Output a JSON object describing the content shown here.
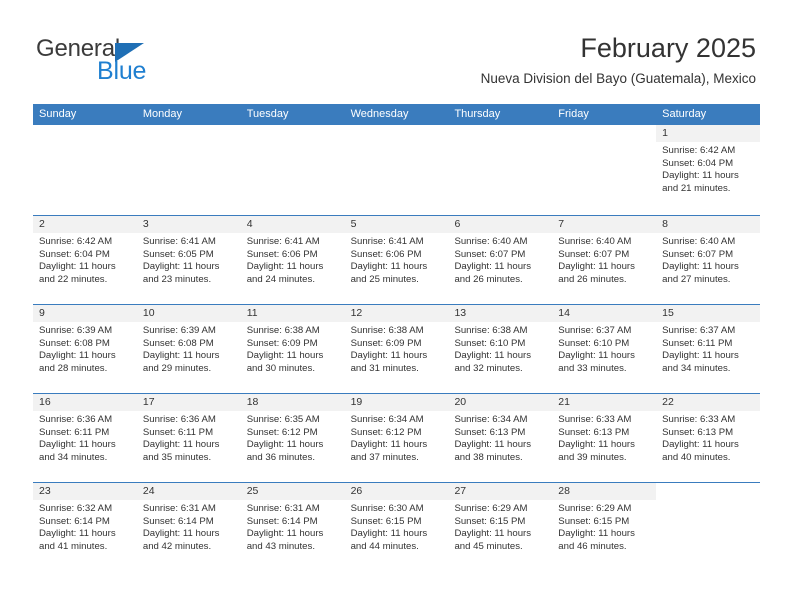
{
  "brand": {
    "name_top": "General",
    "name_bottom": "Blue",
    "triangle_color": "#1f6fb5",
    "blue_color": "#1f7fd0"
  },
  "header": {
    "month_title": "February 2025",
    "location": "Nueva Division del Bayo (Guatemala), Mexico"
  },
  "colors": {
    "header_blue": "#3a7cbe",
    "daynum_band": "#f2f2f2",
    "text": "#333333"
  },
  "weekdays": [
    "Sunday",
    "Monday",
    "Tuesday",
    "Wednesday",
    "Thursday",
    "Friday",
    "Saturday"
  ],
  "labels": {
    "sunrise_prefix": "Sunrise:",
    "sunset_prefix": "Sunset:",
    "daylight_prefix": "Daylight:"
  },
  "weeks": [
    [
      {
        "empty": true
      },
      {
        "empty": true
      },
      {
        "empty": true
      },
      {
        "empty": true
      },
      {
        "empty": true
      },
      {
        "empty": true
      },
      {
        "day": "1",
        "sunrise": "Sunrise: 6:42 AM",
        "sunset": "Sunset: 6:04 PM",
        "daylight": "Daylight: 11 hours and 21 minutes."
      }
    ],
    [
      {
        "day": "2",
        "sunrise": "Sunrise: 6:42 AM",
        "sunset": "Sunset: 6:04 PM",
        "daylight": "Daylight: 11 hours and 22 minutes."
      },
      {
        "day": "3",
        "sunrise": "Sunrise: 6:41 AM",
        "sunset": "Sunset: 6:05 PM",
        "daylight": "Daylight: 11 hours and 23 minutes."
      },
      {
        "day": "4",
        "sunrise": "Sunrise: 6:41 AM",
        "sunset": "Sunset: 6:06 PM",
        "daylight": "Daylight: 11 hours and 24 minutes."
      },
      {
        "day": "5",
        "sunrise": "Sunrise: 6:41 AM",
        "sunset": "Sunset: 6:06 PM",
        "daylight": "Daylight: 11 hours and 25 minutes."
      },
      {
        "day": "6",
        "sunrise": "Sunrise: 6:40 AM",
        "sunset": "Sunset: 6:07 PM",
        "daylight": "Daylight: 11 hours and 26 minutes."
      },
      {
        "day": "7",
        "sunrise": "Sunrise: 6:40 AM",
        "sunset": "Sunset: 6:07 PM",
        "daylight": "Daylight: 11 hours and 26 minutes."
      },
      {
        "day": "8",
        "sunrise": "Sunrise: 6:40 AM",
        "sunset": "Sunset: 6:07 PM",
        "daylight": "Daylight: 11 hours and 27 minutes."
      }
    ],
    [
      {
        "day": "9",
        "sunrise": "Sunrise: 6:39 AM",
        "sunset": "Sunset: 6:08 PM",
        "daylight": "Daylight: 11 hours and 28 minutes."
      },
      {
        "day": "10",
        "sunrise": "Sunrise: 6:39 AM",
        "sunset": "Sunset: 6:08 PM",
        "daylight": "Daylight: 11 hours and 29 minutes."
      },
      {
        "day": "11",
        "sunrise": "Sunrise: 6:38 AM",
        "sunset": "Sunset: 6:09 PM",
        "daylight": "Daylight: 11 hours and 30 minutes."
      },
      {
        "day": "12",
        "sunrise": "Sunrise: 6:38 AM",
        "sunset": "Sunset: 6:09 PM",
        "daylight": "Daylight: 11 hours and 31 minutes."
      },
      {
        "day": "13",
        "sunrise": "Sunrise: 6:38 AM",
        "sunset": "Sunset: 6:10 PM",
        "daylight": "Daylight: 11 hours and 32 minutes."
      },
      {
        "day": "14",
        "sunrise": "Sunrise: 6:37 AM",
        "sunset": "Sunset: 6:10 PM",
        "daylight": "Daylight: 11 hours and 33 minutes."
      },
      {
        "day": "15",
        "sunrise": "Sunrise: 6:37 AM",
        "sunset": "Sunset: 6:11 PM",
        "daylight": "Daylight: 11 hours and 34 minutes."
      }
    ],
    [
      {
        "day": "16",
        "sunrise": "Sunrise: 6:36 AM",
        "sunset": "Sunset: 6:11 PM",
        "daylight": "Daylight: 11 hours and 34 minutes."
      },
      {
        "day": "17",
        "sunrise": "Sunrise: 6:36 AM",
        "sunset": "Sunset: 6:11 PM",
        "daylight": "Daylight: 11 hours and 35 minutes."
      },
      {
        "day": "18",
        "sunrise": "Sunrise: 6:35 AM",
        "sunset": "Sunset: 6:12 PM",
        "daylight": "Daylight: 11 hours and 36 minutes."
      },
      {
        "day": "19",
        "sunrise": "Sunrise: 6:34 AM",
        "sunset": "Sunset: 6:12 PM",
        "daylight": "Daylight: 11 hours and 37 minutes."
      },
      {
        "day": "20",
        "sunrise": "Sunrise: 6:34 AM",
        "sunset": "Sunset: 6:13 PM",
        "daylight": "Daylight: 11 hours and 38 minutes."
      },
      {
        "day": "21",
        "sunrise": "Sunrise: 6:33 AM",
        "sunset": "Sunset: 6:13 PM",
        "daylight": "Daylight: 11 hours and 39 minutes."
      },
      {
        "day": "22",
        "sunrise": "Sunrise: 6:33 AM",
        "sunset": "Sunset: 6:13 PM",
        "daylight": "Daylight: 11 hours and 40 minutes."
      }
    ],
    [
      {
        "day": "23",
        "sunrise": "Sunrise: 6:32 AM",
        "sunset": "Sunset: 6:14 PM",
        "daylight": "Daylight: 11 hours and 41 minutes."
      },
      {
        "day": "24",
        "sunrise": "Sunrise: 6:31 AM",
        "sunset": "Sunset: 6:14 PM",
        "daylight": "Daylight: 11 hours and 42 minutes."
      },
      {
        "day": "25",
        "sunrise": "Sunrise: 6:31 AM",
        "sunset": "Sunset: 6:14 PM",
        "daylight": "Daylight: 11 hours and 43 minutes."
      },
      {
        "day": "26",
        "sunrise": "Sunrise: 6:30 AM",
        "sunset": "Sunset: 6:15 PM",
        "daylight": "Daylight: 11 hours and 44 minutes."
      },
      {
        "day": "27",
        "sunrise": "Sunrise: 6:29 AM",
        "sunset": "Sunset: 6:15 PM",
        "daylight": "Daylight: 11 hours and 45 minutes."
      },
      {
        "day": "28",
        "sunrise": "Sunrise: 6:29 AM",
        "sunset": "Sunset: 6:15 PM",
        "daylight": "Daylight: 11 hours and 46 minutes."
      },
      {
        "empty": true
      }
    ]
  ]
}
